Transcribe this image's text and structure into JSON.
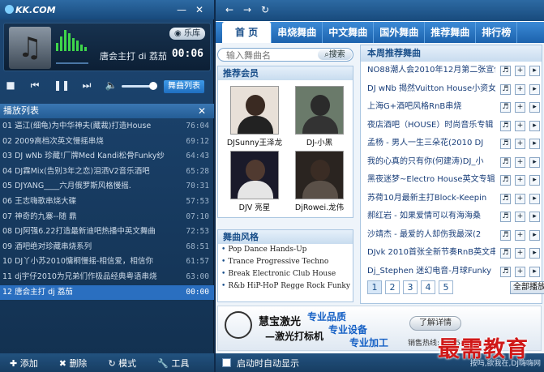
{
  "app": {
    "logo": "KK.COM"
  },
  "player": {
    "skin_label": "乐库",
    "now_playing": "唐会主打 di 荔茄",
    "time": "00:06",
    "list_button": "舞曲列表",
    "eq_levels": [
      0.4,
      0.7,
      1.0,
      0.85,
      0.6,
      0.5,
      0.3,
      0.2
    ]
  },
  "playlist": {
    "header": "播放列表",
    "items": [
      {
        "n": "01",
        "title": "逼江(细龟)为中华神夫(藏裁)打造House",
        "dur": "76:04"
      },
      {
        "n": "02",
        "title": "2009高档次英文慢摇串烧",
        "dur": "69:12"
      },
      {
        "n": "03",
        "title": "DJ wNb 珍藏!厂牌Med Kandi松骨Funky纱",
        "dur": "64:43"
      },
      {
        "n": "04",
        "title": "DJ霖Mix(告别3年之恋)泪洒V2音乐酒吧",
        "dur": "65:28"
      },
      {
        "n": "05",
        "title": "DJYANG____六月俄罗斯风格慢摇.",
        "dur": "70:31"
      },
      {
        "n": "06",
        "title": "王志嗨歌串烧大碟",
        "dur": "57:53"
      },
      {
        "n": "07",
        "title": "神奇的九寨--随 鼎",
        "dur": "07:10"
      },
      {
        "n": "08",
        "title": "DJ阿强6.22打造最新迪吧热播中英文舞曲",
        "dur": "72:53"
      },
      {
        "n": "09",
        "title": "酒吧绝对珍藏串烧系列",
        "dur": "68:51"
      },
      {
        "n": "10",
        "title": "DJ丫小苏2010慵桐慢摇-相信爱，相信你",
        "dur": "61:57"
      },
      {
        "n": "11",
        "title": "dj宇仔2010为兄弟们作极品经典粤语串烧",
        "dur": "63:00"
      },
      {
        "n": "12",
        "title": "唐会主打 dj 荔茄",
        "dur": "00:00"
      }
    ],
    "active_index": 11
  },
  "bottom": {
    "add": "添加",
    "delete": "删除",
    "mode": "模式",
    "tools": "工具"
  },
  "tabs": [
    "首 页",
    "串烧舞曲",
    "中文舞曲",
    "国外舞曲",
    "推荐舞曲",
    "排行榜"
  ],
  "search": {
    "placeholder": "输入舞曲名",
    "button": "搜索"
  },
  "members": {
    "title": "推荐会员",
    "items": [
      "DJSunny王泽龙",
      "DJ-小黑",
      "DJV 亮星",
      "DjRowei.龙伟"
    ]
  },
  "styles": {
    "title": "舞曲风格",
    "items": [
      "Pop Dance Hands-Up",
      "Trance Progressive Techno",
      "Break Electronic Club House",
      "R&b HiP-HoP Regge Rock Funky"
    ]
  },
  "weekly": {
    "title": "本周推荐舞曲",
    "songs": [
      "NO88潮人会2010年12月第二张宣传",
      "DJ wNb 揭然Vuitton House小资女",
      "上海G+酒吧风格RnB串烧",
      "夜店酒吧（HOUSE）时尚音乐专辑",
      "孟杨 - 男人一生三朵花(2010 DJ",
      "我的心真的只有你(何建涛)DJ_小",
      "黑夜迷梦~Electro House英文专辑",
      "苏荷10月最新主打Block-Keepin",
      "郝红岩 - 如果爱情可以有海海桑",
      "沙靖杰 - 最爱的人却伤我最深(2",
      "DJvk 2010首张全新节奏RnB英文串",
      "Dj_Stephen 迷幻电音-月球Funky"
    ],
    "pages": [
      "1",
      "2",
      "3",
      "4",
      "5"
    ],
    "play_all": "全部播放"
  },
  "banner": {
    "name": "慧宝激光",
    "sub": "—激光打标机",
    "q1": "专业品质",
    "q2": "专业设备",
    "q3": "专业加工",
    "detail": "了解详情",
    "phone": "销售热线: 0755-2"
  },
  "status": {
    "autostart": "启动时自动显示",
    "right": "按吗,欲我在,DJ嗨嗨网"
  },
  "watermark": "最需教育",
  "colors": {
    "accent": "#2a6fc0",
    "panel_bg": "#0f2a4a",
    "tab_bar": "#1c62ad"
  }
}
